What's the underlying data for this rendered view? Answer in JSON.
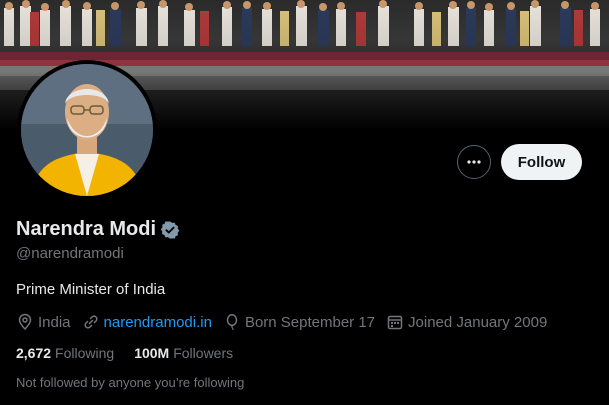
{
  "profile": {
    "name": "Narendra Modi",
    "handle": "@narendramodi",
    "bio": "Prime Minister of India",
    "location": "India",
    "website": "narendramodi.in",
    "born": "Born September 17",
    "joined": "Joined January 2009"
  },
  "actions": {
    "follow_label": "Follow",
    "more_icon": "more-horizontal-icon"
  },
  "counts": {
    "following_value": "2,672",
    "following_label": "Following",
    "followers_value": "100M",
    "followers_label": "Followers"
  },
  "note": "Not followed by anyone you’re following",
  "colors": {
    "background": "#000000",
    "primary_text": "#e7e9ea",
    "secondary_text": "#71767b",
    "link": "#1d9bf0",
    "verified_badge": "#829aab",
    "follow_button_bg": "#eff3f4"
  }
}
